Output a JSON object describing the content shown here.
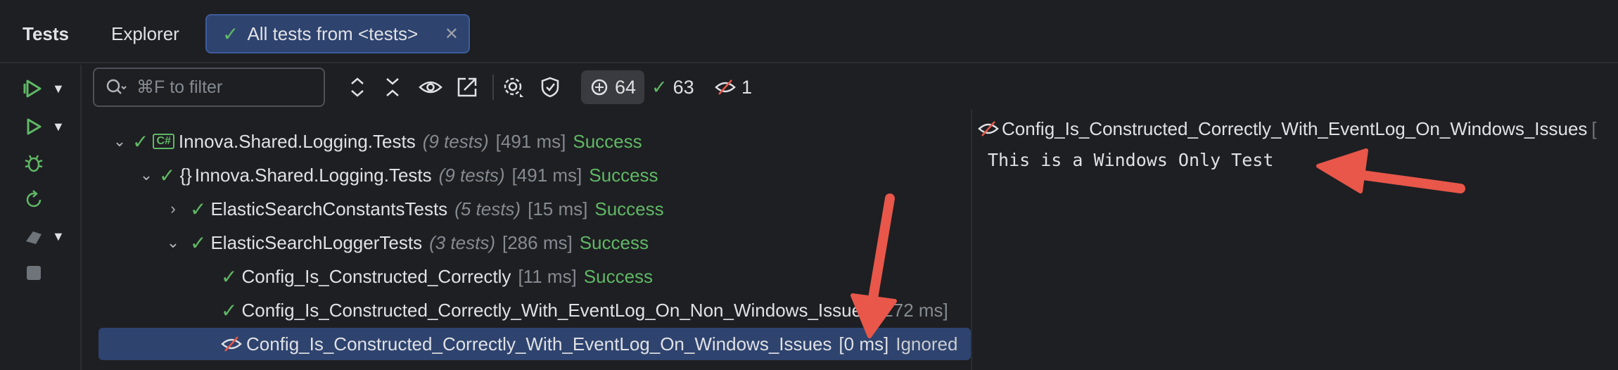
{
  "tabs": {
    "title": "Tests",
    "explorer": "Explorer",
    "run": "All tests from <tests>",
    "run_close": "✕"
  },
  "toolbar": {
    "filter_placeholder": "⌘F to filter",
    "counts": {
      "total": "64",
      "passed": "63",
      "ignored": "1"
    }
  },
  "tree": {
    "rows": [
      {
        "name": "Innova.Shared.Logging.Tests",
        "count": "(9 tests)",
        "time": "[491 ms]",
        "status": "Success",
        "kind": "project"
      },
      {
        "name": "Innova.Shared.Logging.Tests",
        "count": "(9 tests)",
        "time": "[491 ms]",
        "status": "Success",
        "kind": "namespace"
      },
      {
        "name": "ElasticSearchConstantsTests",
        "count": "(5 tests)",
        "time": "[15 ms]",
        "status": "Success",
        "kind": "class-collapsed"
      },
      {
        "name": "ElasticSearchLoggerTests",
        "count": "(3 tests)",
        "time": "[286 ms]",
        "status": "Success",
        "kind": "class-expanded"
      },
      {
        "name": "Config_Is_Constructed_Correctly",
        "time": "[11 ms]",
        "status": "Success",
        "kind": "test"
      },
      {
        "name": "Config_Is_Constructed_Correctly_With_EventLog_On_Non_Windows_Issues",
        "time": "[272 ms]",
        "status": "",
        "kind": "test"
      },
      {
        "name": "Config_Is_Constructed_Correctly_With_EventLog_On_Windows_Issues",
        "time": "[0 ms]",
        "status": "Ignored",
        "kind": "test-ignored"
      }
    ]
  },
  "output": {
    "title": "Config_Is_Constructed_Correctly_With_EventLog_On_Windows_Issues",
    "title_tail": "[",
    "text": "This is a Windows Only Test"
  },
  "colors": {
    "success": "#5fb865",
    "selection": "#2e436e",
    "arrow": "#e8574a"
  },
  "icons": [
    "run-all-icon",
    "run-icon",
    "debug-icon",
    "rerun-icon",
    "coverage-icon",
    "stop-icon",
    "search-icon",
    "expand-all-icon",
    "collapse-all-icon",
    "show-icon",
    "export-icon",
    "settings-icon",
    "track-tests-icon",
    "ignored-icon",
    "check-icon"
  ]
}
